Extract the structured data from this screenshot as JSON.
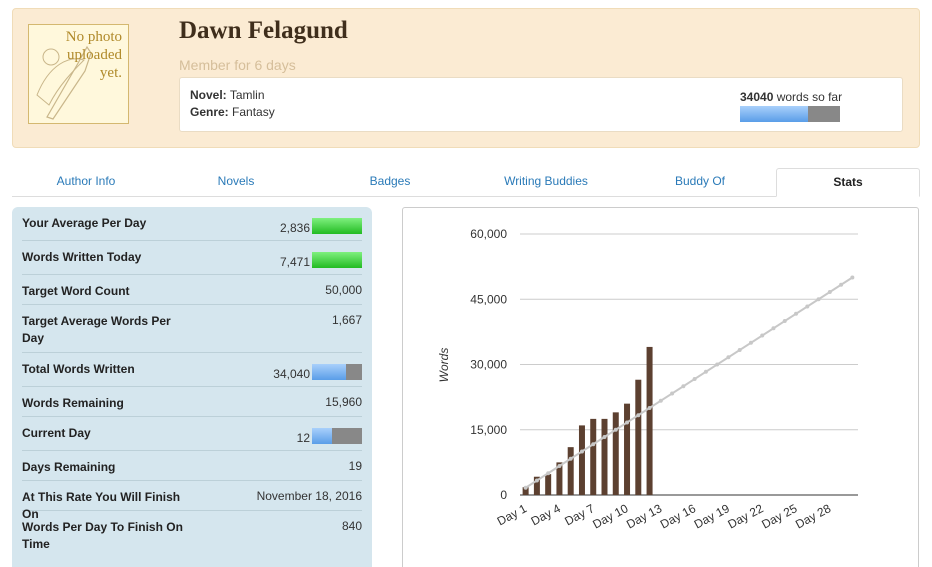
{
  "profile": {
    "photo_text": [
      "No photo",
      "uploaded",
      "yet."
    ],
    "name": "Dawn Felagund",
    "member_for": "Member for 6 days",
    "novel_label": "Novel:",
    "novel_value": "Tamlin",
    "genre_label": "Genre:",
    "genre_value": "Fantasy",
    "words_count": "34040",
    "words_suffix": "words so far",
    "progress_fraction": 0.68
  },
  "tabs": [
    {
      "label": "Author Info",
      "active": false
    },
    {
      "label": "Novels",
      "active": false
    },
    {
      "label": "Badges",
      "active": false
    },
    {
      "label": "Writing Buddies",
      "active": false
    },
    {
      "label": "Buddy Of",
      "active": false
    },
    {
      "label": "Stats",
      "active": true
    }
  ],
  "stats": [
    {
      "label": "Your Average Per Day",
      "value": "2,836",
      "bar": "green",
      "fraction": 1.0
    },
    {
      "label": "Words Written Today",
      "value": "7,471",
      "bar": "green",
      "fraction": 1.0
    },
    {
      "label": "Target Word Count",
      "value": "50,000"
    },
    {
      "label": "Target Average Words Per Day",
      "value": "1,667"
    },
    {
      "label": "Total Words Written",
      "value": "34,040",
      "bar": "blue",
      "fraction": 0.68
    },
    {
      "label": "Words Remaining",
      "value": "15,960"
    },
    {
      "label": "Current Day",
      "value": "12",
      "bar": "blue",
      "fraction": 0.4
    },
    {
      "label": "Days Remaining",
      "value": "19"
    },
    {
      "label": "At This Rate You Will Finish On",
      "value": "November 18, 2016"
    },
    {
      "label": "Words Per Day To Finish On Time",
      "value": "840"
    }
  ],
  "chart_data": {
    "type": "bar",
    "ylabel": "Words",
    "ylim": [
      0,
      60000
    ],
    "yticks": [
      "0",
      "15,000",
      "30,000",
      "45,000",
      "60,000"
    ],
    "ytick_values": [
      0,
      15000,
      30000,
      45000,
      60000
    ],
    "xtick_labels": [
      "Day 1",
      "Day 4",
      "Day 7",
      "Day 10",
      "Day 13",
      "Day 16",
      "Day 19",
      "Day 22",
      "Day 25",
      "Day 28"
    ],
    "xtick_days": [
      1,
      4,
      7,
      10,
      13,
      16,
      19,
      22,
      25,
      28
    ],
    "days": 30,
    "series": [
      {
        "type": "bar",
        "color": "#5c4030",
        "x": [
          1,
          2,
          3,
          4,
          5,
          6,
          7,
          8,
          9,
          10,
          11,
          12
        ],
        "values": [
          1800,
          4200,
          4800,
          7500,
          11000,
          16000,
          17500,
          17500,
          19000,
          21000,
          26500,
          34040
        ]
      },
      {
        "type": "line",
        "color": "#c8c8c8",
        "x": [
          1,
          30
        ],
        "values": [
          1667,
          50000
        ]
      }
    ]
  }
}
